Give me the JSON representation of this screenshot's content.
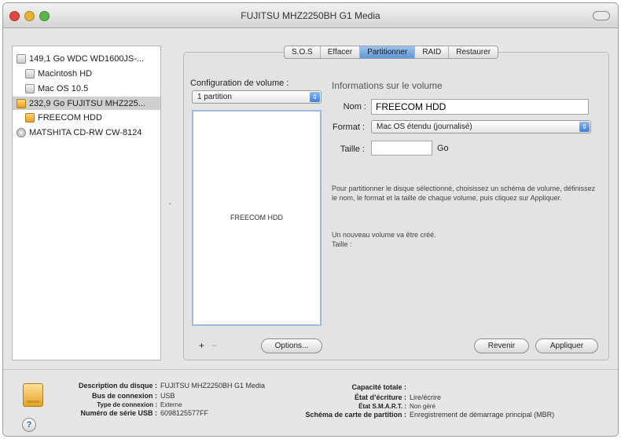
{
  "window": {
    "title": "FUJITSU MHZ2250BH G1 Media"
  },
  "sidebar": {
    "items": [
      {
        "label": "149,1 Go WDC WD1600JS-...",
        "icon": "hard-disk-icon"
      },
      {
        "label": "Macintosh HD",
        "icon": "volume-icon"
      },
      {
        "label": "Mac OS 10.5",
        "icon": "volume-icon"
      },
      {
        "label": "232,9 Go FUJITSU MHZ225...",
        "icon": "external-disk-icon"
      },
      {
        "label": "FREECOM HDD",
        "icon": "external-volume-icon"
      },
      {
        "label": "MATSHITA CD-RW CW-8124",
        "icon": "optical-drive-icon"
      }
    ]
  },
  "tabs": [
    "S.O.S",
    "Effacer",
    "Partitionner",
    "RAID",
    "Restaurer"
  ],
  "partition": {
    "config_label": "Configuration de volume :",
    "scheme_value": "1 partition",
    "layout_volume_name": "FREECOM HDD",
    "add_symbol": "+",
    "remove_symbol": "−",
    "options_label": "Options...",
    "info_title": "Informations sur le volume",
    "name_label": "Nom :",
    "name_value": "FREECOM HDD",
    "format_label": "Format :",
    "format_value": "Mac OS étendu (journalisé)",
    "size_label": "Taille :",
    "size_value": "",
    "size_unit": "Go",
    "description": "Pour partitionner le disque sélectionné, choisissez un schéma de volume, définissez le nom, le format et la taille de chaque volume, puis cliquez sur Appliquer.",
    "new_volume_text": "Un nouveau volume va être créé.",
    "new_volume_size_label": "Taille :",
    "revert_label": "Revenir",
    "apply_label": "Appliquer"
  },
  "disk_info": {
    "description_label": "Description du disque :",
    "description_value": "FUJITSU MHZ2250BH G1 Media",
    "bus_label": "Bus de connexion :",
    "bus_value": "USB",
    "connection_type_label": "Type de connexion :",
    "connection_type_value": "Externe",
    "serial_label": "Numéro de série USB :",
    "serial_value": "6098125577FF",
    "capacity_label": "Capacité totale :",
    "capacity_value": "",
    "write_status_label": "État d’écriture :",
    "write_status_value": "Lire/écrire",
    "smart_label": "État S.M.A.R.T. :",
    "smart_value": "Non géré",
    "partition_map_label": "Schéma de carte de partition :",
    "partition_map_value": "Enregistrement de démarrage principal (MBR)",
    "help_symbol": "?"
  },
  "colors": {
    "selection": "#cfcfcf",
    "accent": "#5d95d8",
    "disk_orange": "#e7a025"
  }
}
